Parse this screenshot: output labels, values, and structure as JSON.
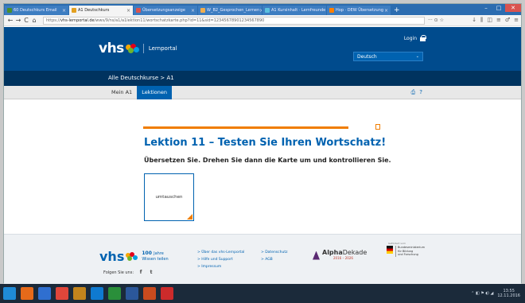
{
  "browser": {
    "tabs": [
      {
        "label": "60 Deutschkurs Email",
        "favcolor": "#4a8f2a"
      },
      {
        "label": "A1 Deutschkurs",
        "favcolor": "#e3a020",
        "active": true
      },
      {
        "label": "Übersetzungsanzeige",
        "favcolor": "#d9534f"
      },
      {
        "label": "W_B2_Gesprochen_Lernen",
        "favcolor": "#f0ad4e"
      },
      {
        "label": "A1 Kursinhalt · Lernfreunde",
        "favcolor": "#5bc0de"
      },
      {
        "label": "Hop · DEW Übersetzung",
        "favcolor": "#ff7f00"
      }
    ],
    "url_prefix": "https://",
    "url_domain": "vhs-lernportal.de",
    "url_path": "/wws/9/ns/a1/a1lektion11/wortschatzkarte.php?id=11&sid=12345678901234567890",
    "back": "←",
    "forward": "→",
    "reload": "C",
    "home": "⌂",
    "more": "··· ⊙ ☆",
    "toolbar_icons": [
      "↓",
      "⫼",
      "◫",
      "≡",
      "♂",
      "≡"
    ],
    "win_min": "–",
    "win_max": "□",
    "win_close": "✕",
    "new_tab": "+"
  },
  "header": {
    "logo_text": "vhs",
    "portal_label": "Lernportal",
    "login_label": "Login",
    "language": "Deutsch",
    "chevron": "⌄"
  },
  "breadcrumb": "Alle Deutschkurse  >  A1",
  "subnav": {
    "items": [
      "Mein A1",
      "Lektionen"
    ],
    "print_icon": "⎙",
    "help_icon": "?"
  },
  "lesson": {
    "title": "Lektion 11 – Testen Sie Ihren Wortschatz!",
    "instruction": "Übersetzen Sie. Drehen Sie dann die Karte um und kontrollieren Sie.",
    "card_word": "umtauschen"
  },
  "footer": {
    "logo_text": "vhs",
    "jahre_number": "100",
    "jahre_word": "Jahre",
    "tagline": "Wissen teilen",
    "follow_label": "Folgen Sie uns:",
    "facebook": "f",
    "twitter": "t",
    "links": [
      "> Über das vhs-Lernportal",
      "> Datenschutz",
      "> Hilfe und Support",
      "> AGB",
      "> Impressum"
    ],
    "alpha_bold": "Alpha",
    "alpha_rest": "Dekade",
    "alpha_years": "2016 – 2026",
    "bmbf_prefix": "Gefördert vom",
    "bmbf_text": "Bundesministerium\nfür Bildung\nund Forschung"
  },
  "taskbar": {
    "apps": [
      "#1f8bd6",
      "#e66a1a",
      "#2f6fd0",
      "#e0463a",
      "#c2841c",
      "#0f7ad1",
      "#2a8f3a",
      "#2b579a",
      "#c94b1e",
      "#cc2b2b"
    ],
    "tray": "⌃  ◧  ⚑  ◖)  ◢",
    "time": "13:55",
    "date": "12.11.2016"
  }
}
